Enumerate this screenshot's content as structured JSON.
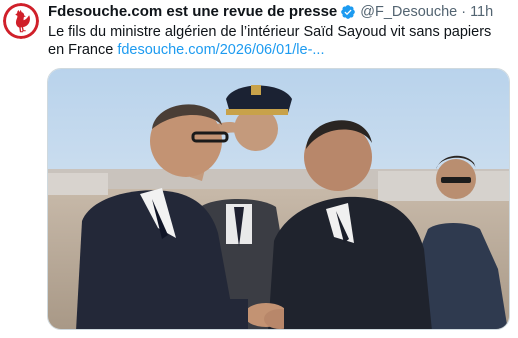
{
  "tweet": {
    "display_name": "Fdesouche.com est une revue de presse",
    "handle": "@F_Desouche",
    "separator": "·",
    "time": "11h",
    "text": "Le fils du ministre algérien de l’intérieur Saïd Sayoud vit sans papiers en France ",
    "link_text": "fdesouche.com/2026/06/01/le-...",
    "avatar_icon": "rooster-logo-icon",
    "verified_icon": "verified-badge-icon"
  },
  "colors": {
    "avatar_red": "#d0202a",
    "verified_blue": "#1d9bf0",
    "link_blue": "#1d9bf0",
    "muted_gray": "#536471"
  }
}
